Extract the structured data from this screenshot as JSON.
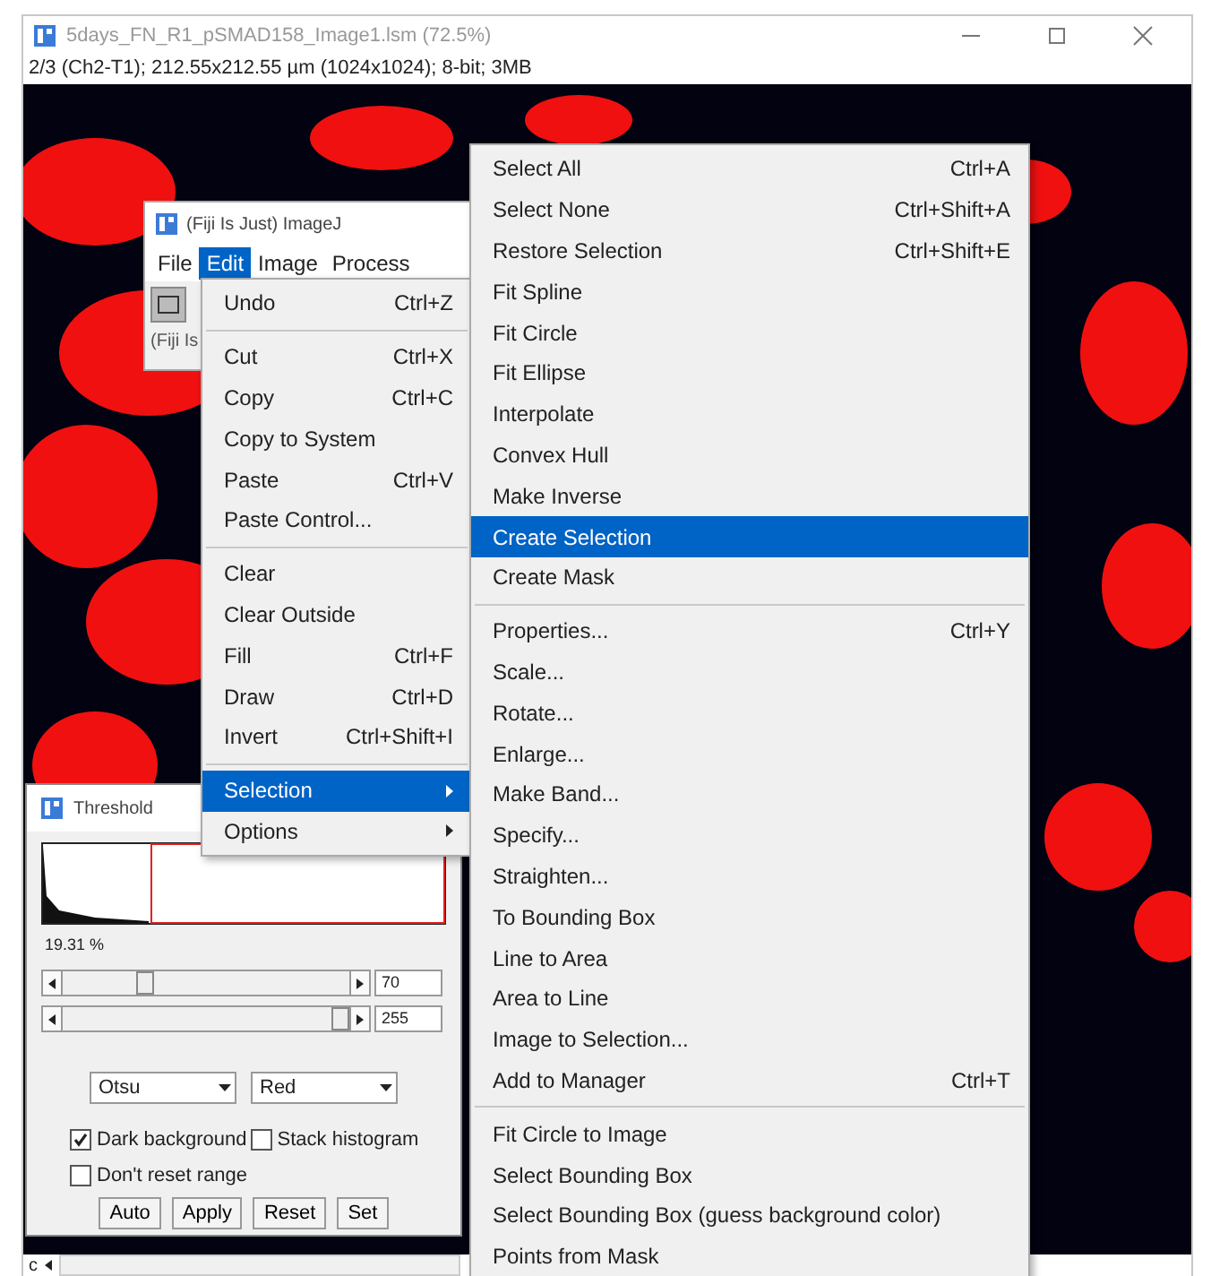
{
  "image_window": {
    "title": "5days_FN_R1_pSMAD158_Image1.lsm (72.5%)",
    "info": "2/3 (Ch2-T1); 212.55x212.55 µm (1024x1024); 8-bit; 3MB",
    "channel_label": "c"
  },
  "imagej_window": {
    "title": "(Fiji Is Just) ImageJ",
    "menus": [
      {
        "label": "File",
        "selected": false
      },
      {
        "label": "Edit",
        "selected": true
      },
      {
        "label": "Image",
        "selected": false
      },
      {
        "label": "Process",
        "selected": false
      }
    ],
    "status": "(Fiji Is"
  },
  "edit_menu": {
    "items": [
      {
        "kind": "item",
        "label": "Undo",
        "shortcut": "Ctrl+Z",
        "selected": false
      },
      {
        "kind": "separator"
      },
      {
        "kind": "item",
        "label": "Cut",
        "shortcut": "Ctrl+X",
        "selected": false
      },
      {
        "kind": "item",
        "label": "Copy",
        "shortcut": "Ctrl+C",
        "selected": false
      },
      {
        "kind": "item",
        "label": "Copy to System",
        "selected": false
      },
      {
        "kind": "item",
        "label": "Paste",
        "shortcut": "Ctrl+V",
        "selected": false
      },
      {
        "kind": "item",
        "label": "Paste Control...",
        "selected": false
      },
      {
        "kind": "separator"
      },
      {
        "kind": "item",
        "label": "Clear",
        "selected": false
      },
      {
        "kind": "item",
        "label": "Clear Outside",
        "selected": false
      },
      {
        "kind": "item",
        "label": "Fill",
        "shortcut": "Ctrl+F",
        "selected": false
      },
      {
        "kind": "item",
        "label": "Draw",
        "shortcut": "Ctrl+D",
        "selected": false
      },
      {
        "kind": "item",
        "label": "Invert",
        "shortcut": "Ctrl+Shift+I",
        "selected": false
      },
      {
        "kind": "separator"
      },
      {
        "kind": "submenu",
        "label": "Selection",
        "selected": true
      },
      {
        "kind": "submenu",
        "label": "Options",
        "selected": false
      }
    ]
  },
  "selection_menu": {
    "items": [
      {
        "kind": "item",
        "label": "Select All",
        "shortcut": "Ctrl+A",
        "selected": false
      },
      {
        "kind": "item",
        "label": "Select None",
        "shortcut": "Ctrl+Shift+A",
        "selected": false
      },
      {
        "kind": "item",
        "label": "Restore Selection",
        "shortcut": "Ctrl+Shift+E",
        "selected": false
      },
      {
        "kind": "item",
        "label": "Fit Spline",
        "selected": false
      },
      {
        "kind": "item",
        "label": "Fit Circle",
        "selected": false
      },
      {
        "kind": "item",
        "label": "Fit Ellipse",
        "selected": false
      },
      {
        "kind": "item",
        "label": "Interpolate",
        "selected": false
      },
      {
        "kind": "item",
        "label": "Convex Hull",
        "selected": false
      },
      {
        "kind": "item",
        "label": "Make Inverse",
        "selected": false
      },
      {
        "kind": "item",
        "label": "Create Selection",
        "selected": true
      },
      {
        "kind": "item",
        "label": "Create Mask",
        "selected": false
      },
      {
        "kind": "separator"
      },
      {
        "kind": "item",
        "label": "Properties...",
        "shortcut": "Ctrl+Y",
        "selected": false
      },
      {
        "kind": "item",
        "label": "Scale...",
        "selected": false
      },
      {
        "kind": "item",
        "label": "Rotate...",
        "selected": false
      },
      {
        "kind": "item",
        "label": "Enlarge...",
        "selected": false
      },
      {
        "kind": "item",
        "label": "Make Band...",
        "selected": false
      },
      {
        "kind": "item",
        "label": "Specify...",
        "selected": false
      },
      {
        "kind": "item",
        "label": "Straighten...",
        "selected": false
      },
      {
        "kind": "item",
        "label": "To Bounding Box",
        "selected": false
      },
      {
        "kind": "item",
        "label": "Line to Area",
        "selected": false
      },
      {
        "kind": "item",
        "label": "Area to Line",
        "selected": false
      },
      {
        "kind": "item",
        "label": "Image to Selection...",
        "selected": false
      },
      {
        "kind": "item",
        "label": "Add to Manager",
        "shortcut": "Ctrl+T",
        "selected": false
      },
      {
        "kind": "separator"
      },
      {
        "kind": "item",
        "label": "Fit Circle to Image",
        "selected": false
      },
      {
        "kind": "item",
        "label": "Select Bounding Box",
        "selected": false
      },
      {
        "kind": "item",
        "label": "Select Bounding Box (guess background color)",
        "selected": false
      },
      {
        "kind": "item",
        "label": "Points from Mask",
        "selected": false
      }
    ]
  },
  "threshold": {
    "title": "Threshold",
    "percent": "19.31 %",
    "sliders": [
      {
        "level": 0.27,
        "value": "70"
      },
      {
        "level": 1.0,
        "value": "255"
      }
    ],
    "method": "Otsu",
    "mode": "Red",
    "checkboxes": [
      {
        "label": "Dark background",
        "checked": true
      },
      {
        "label": "Stack histogram",
        "checked": false
      },
      {
        "label": "Don't reset range",
        "checked": false
      }
    ],
    "buttons": [
      "Auto",
      "Apply",
      "Reset",
      "Set"
    ]
  }
}
